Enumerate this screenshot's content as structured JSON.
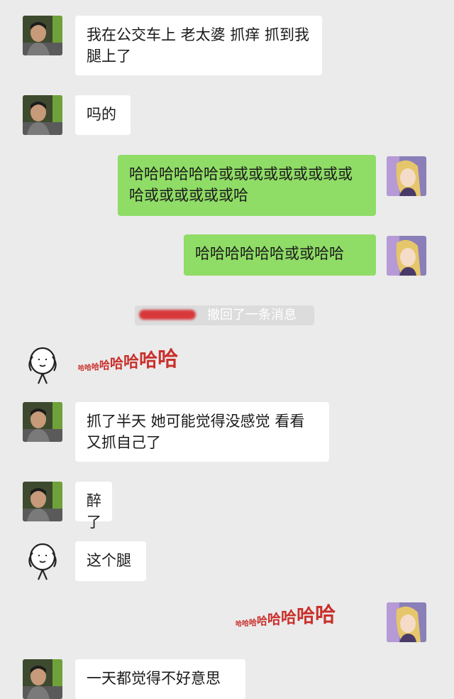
{
  "messages": [
    {
      "id": "m1",
      "text": "我在公交车上  老太婆  抓痒  抓到我腿上了"
    },
    {
      "id": "m2",
      "text": "吗的"
    },
    {
      "id": "m3",
      "text": "哈哈哈哈哈哈或或或或或或或或或哈或或或或或或哈"
    },
    {
      "id": "m4",
      "text": "哈哈哈哈哈哈或或哈哈"
    },
    {
      "id": "m5",
      "text": "抓了半天  她可能觉得没感觉  看看  又抓自己了"
    },
    {
      "id": "m6",
      "text": "醉了"
    },
    {
      "id": "m7",
      "text": "这个腿"
    },
    {
      "id": "m8",
      "text": "一天都觉得不好意思"
    }
  ],
  "system_notice": {
    "text": "撤回了一条消息"
  },
  "stickers": {
    "left_laugh": [
      "哈",
      "哈",
      "哈",
      "哈",
      "哈",
      "哈",
      "哈",
      "哈"
    ],
    "right_laugh": [
      "哈",
      "哈",
      "哈",
      "哈",
      "哈",
      "哈",
      "哈",
      "哈"
    ]
  },
  "colors": {
    "background": "#ebebeb",
    "sent_bubble": "#8fdc66",
    "received_bubble": "#ffffff",
    "laugh_text": "#c9302c"
  }
}
